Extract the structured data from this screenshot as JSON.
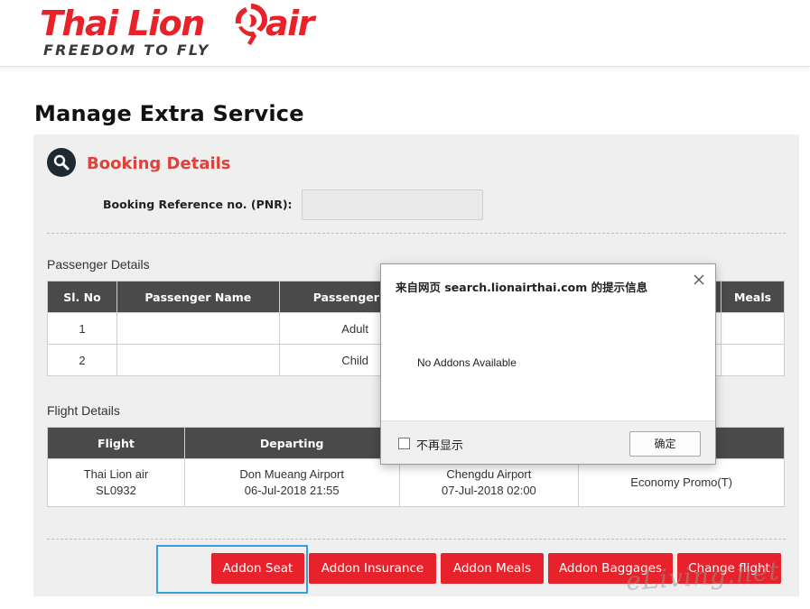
{
  "header": {
    "logo_text": "Thai Lion",
    "logo_text_2": "air",
    "tagline": "FREEDOM TO FLY",
    "brand_color": "#e8222b"
  },
  "page_title": "Manage Extra Service",
  "booking": {
    "title": "Booking Details",
    "pnr_label": "Booking Reference no. (PNR):",
    "pnr_value": ""
  },
  "passenger": {
    "section_label": "Passenger Details",
    "columns": [
      "Sl. No",
      "Passenger Name",
      "Passenger Ty",
      "",
      "Meals"
    ],
    "rows": [
      {
        "sl": "1",
        "name": "",
        "type": "Adult",
        "extra": "",
        "meals": ""
      },
      {
        "sl": "2",
        "name": "",
        "type": "Child",
        "extra": "",
        "meals": ""
      }
    ]
  },
  "flight": {
    "section_label": "Flight Details",
    "columns": [
      "Flight",
      "Departing",
      "",
      ""
    ],
    "rows": [
      {
        "flight_line1": "Thai Lion air",
        "flight_line2": "SL0932",
        "dep_line1": "Don Mueang Airport",
        "dep_line2": "06-Jul-2018 21:55",
        "arr_line1": "Chengdu Airport",
        "arr_line2": "07-Jul-2018 02:00",
        "fare": "Economy Promo(T)"
      }
    ]
  },
  "buttons": {
    "addon_seat": "Addon Seat",
    "addon_insurance": "Addon Insurance",
    "addon_meals": "Addon Meals",
    "addon_baggages": "Addon Baggages",
    "change_flight": "Change flight"
  },
  "dialog": {
    "title": "来自网页 search.lionairthai.com 的提示信息",
    "message": "No Addons Available",
    "checkbox_label": "不再显示",
    "ok_label": "确定"
  },
  "watermark": "eLiving.net",
  "colors": {
    "accent": "#e8222b",
    "heading_red": "#e0413a",
    "table_header": "#4a4a4a",
    "panel_bg": "#efefef",
    "focus_ring": "#3aa0d8"
  }
}
